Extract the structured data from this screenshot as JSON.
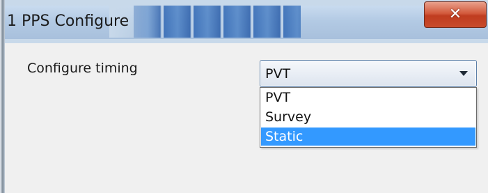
{
  "window": {
    "title": "1 PPS Configure",
    "close_icon": "close-icon",
    "close_glyph": "✕"
  },
  "form": {
    "configure_timing": {
      "label": "Configure timing",
      "selected_value": "PVT",
      "dropdown_icon": "chevron-down-icon",
      "options": [
        "PVT",
        "Survey",
        "Static"
      ],
      "highlighted_option": "Static"
    }
  },
  "colors": {
    "selection_highlight": "#3399ff",
    "close_button": "#c84b2c",
    "dialog_background": "#f0f0f0"
  }
}
